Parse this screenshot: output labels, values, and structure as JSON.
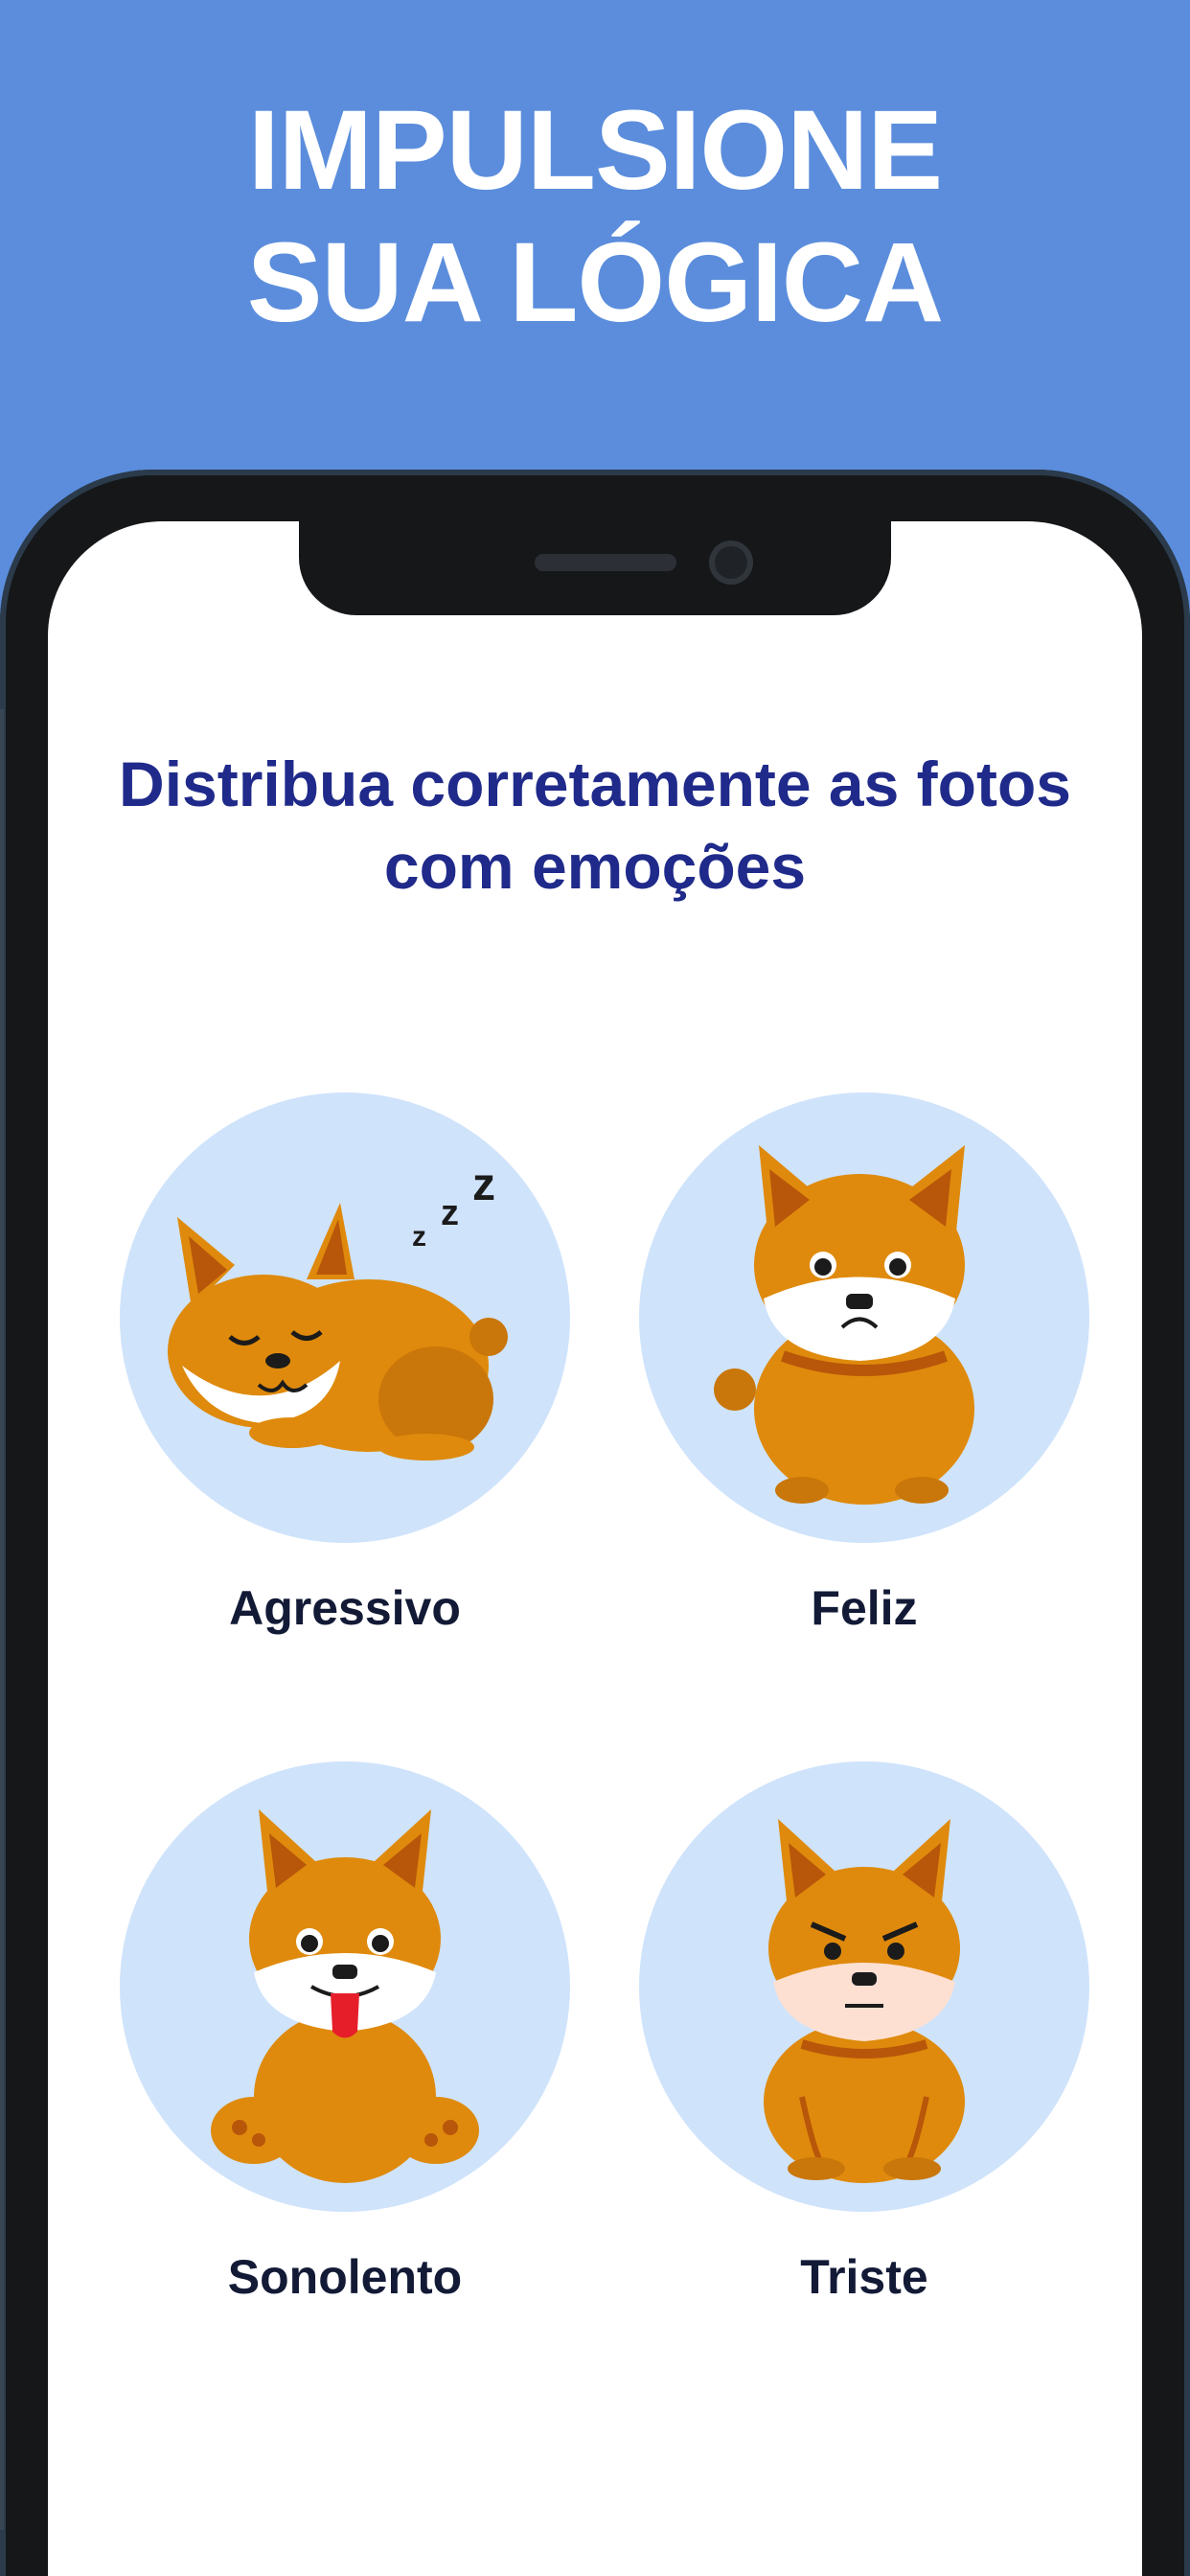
{
  "headline": {
    "line1": "IMPULSIONE",
    "line2": "SUA LÓGICA"
  },
  "task": {
    "prompt": "Distribua corretamente as fotos com emoções"
  },
  "options": [
    {
      "label": "Agressivo",
      "image": "sleeping-dog-icon"
    },
    {
      "label": "Feliz",
      "image": "worried-dog-icon"
    },
    {
      "label": "Sonolento",
      "image": "happy-dog-icon"
    },
    {
      "label": "Triste",
      "image": "angry-dog-icon"
    }
  ],
  "colors": {
    "background": "#5b8ddc",
    "headline": "#ffffff",
    "prompt": "#1f2a8a",
    "label": "#121a36",
    "circle": "#cfe3fb",
    "dog_fur": "#df8a0c",
    "dog_ears": "#b8560a"
  }
}
